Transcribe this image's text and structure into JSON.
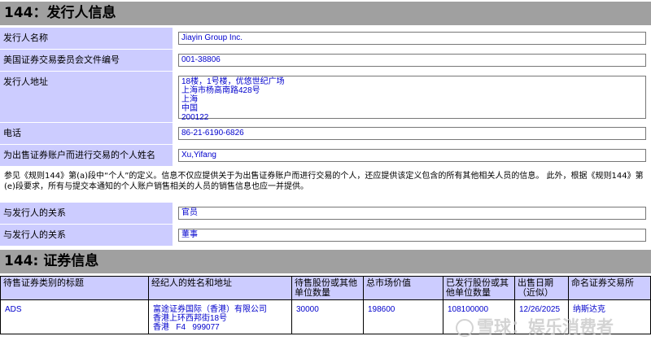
{
  "issuer_section": {
    "title": "144：发行人信息",
    "fields": [
      {
        "label": "发行人名称",
        "value": "Jiayin Group Inc."
      },
      {
        "label": "美国证券交易委员会文件编号",
        "value": "001-38806"
      },
      {
        "label": "发行人地址",
        "lines": [
          "18楼，1号楼，优悠世纪广场",
          "上海市杨高南路428号",
          "上海",
          "中国",
          "200122"
        ]
      },
      {
        "label": "电话",
        "value": "86-21-6190-6826"
      },
      {
        "label": "为出售证券账户而进行交易的个人姓名",
        "value": "Xu,Yifang"
      }
    ],
    "note": "参见《规则144》第(a)段中“个人”的定义。信息不仅应提供关于为出售证券账户而进行交易的个人，还应提供该定义包含的所有其他相关人员的信息。 此外，根据《规则144》第(e)段要求，所有与提交本通知的个人账户销售相关的人员的销售信息也应一并提供。",
    "relations": [
      {
        "label": "与发行人的关系",
        "value": "官员"
      },
      {
        "label": "与发行人的关系",
        "value": "董事"
      }
    ]
  },
  "securities_section": {
    "title": "144: 证券信息",
    "headers": [
      "待售证券类别的标题",
      "经纪人的姓名和地址",
      "待售股份或其他单位数量",
      "总市场价值",
      "已发行股份或其他单位数量",
      "出售日期（近似）",
      "命名证券交易所"
    ],
    "rows": [
      {
        "class_title": "ADS",
        "broker_lines": [
          "富途证券国际（香港）有限公司",
          "香港上环西邦街18号",
          "香港   F4   999077"
        ],
        "units_to_sell": "30000",
        "market_value": "198600",
        "units_outstanding": "108100000",
        "sale_date": "12/26/2025",
        "exchange": "纳斯达克"
      }
    ]
  },
  "watermark": {
    "text": "雪球：娱乐消费者"
  }
}
